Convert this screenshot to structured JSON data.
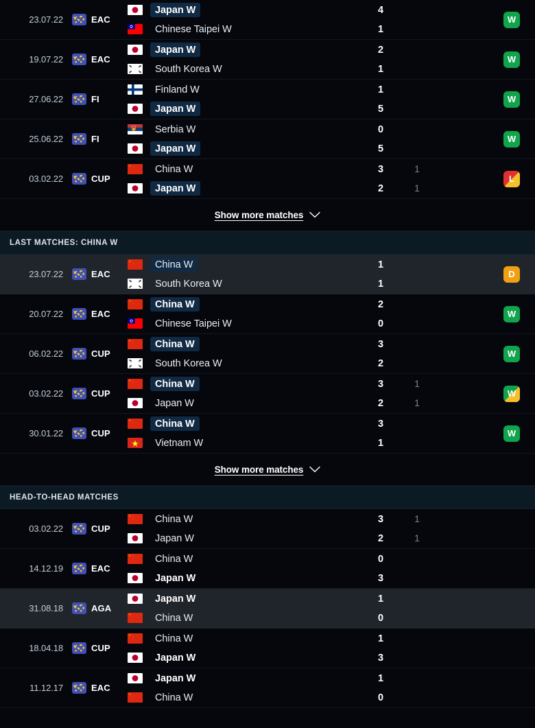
{
  "colors": {
    "page_bg": "#05070d",
    "row_alt_bg": "#20242b",
    "section_header_bg": "#0c1a23",
    "highlight_team_bg": "#112a44",
    "win": "#10a44c",
    "draw": "#f0a011",
    "loss": "#e03030",
    "penalty_corner": "#f5c02a",
    "comp_icon_bg": "#3f51b5"
  },
  "sections": [
    {
      "id": "last-matches-japan",
      "header": null,
      "show_more": {
        "label": "Show more matches",
        "icon": "chevron-down-icon"
      },
      "matches": [
        {
          "date": "23.07.22",
          "competition": "EAC",
          "competition_icon": "world-map-icon",
          "row_highlight": false,
          "home": {
            "team": "Japan W",
            "flag": "japan-flag",
            "score": "4",
            "penalty": "",
            "highlight": true,
            "bold": true
          },
          "away": {
            "team": "Chinese Taipei W",
            "flag": "chinese-taipei-flag",
            "score": "1",
            "penalty": "",
            "highlight": false,
            "bold": false
          },
          "result": {
            "letter": "W",
            "type": "w",
            "corner": false
          }
        },
        {
          "date": "19.07.22",
          "competition": "EAC",
          "competition_icon": "world-map-icon",
          "row_highlight": false,
          "home": {
            "team": "Japan W",
            "flag": "japan-flag",
            "score": "2",
            "penalty": "",
            "highlight": true,
            "bold": true
          },
          "away": {
            "team": "South Korea W",
            "flag": "south-korea-flag",
            "score": "1",
            "penalty": "",
            "highlight": false,
            "bold": false
          },
          "result": {
            "letter": "W",
            "type": "w",
            "corner": false
          }
        },
        {
          "date": "27.06.22",
          "competition": "FI",
          "competition_icon": "world-map-icon",
          "row_highlight": false,
          "home": {
            "team": "Finland W",
            "flag": "finland-flag",
            "score": "1",
            "penalty": "",
            "highlight": false,
            "bold": false
          },
          "away": {
            "team": "Japan W",
            "flag": "japan-flag",
            "score": "5",
            "penalty": "",
            "highlight": true,
            "bold": true
          },
          "result": {
            "letter": "W",
            "type": "w",
            "corner": false
          }
        },
        {
          "date": "25.06.22",
          "competition": "FI",
          "competition_icon": "world-map-icon",
          "row_highlight": false,
          "home": {
            "team": "Serbia W",
            "flag": "serbia-flag",
            "score": "0",
            "penalty": "",
            "highlight": false,
            "bold": false
          },
          "away": {
            "team": "Japan W",
            "flag": "japan-flag",
            "score": "5",
            "penalty": "",
            "highlight": true,
            "bold": true
          },
          "result": {
            "letter": "W",
            "type": "w",
            "corner": false
          }
        },
        {
          "date": "03.02.22",
          "competition": "CUP",
          "competition_icon": "world-map-icon",
          "row_highlight": false,
          "home": {
            "team": "China W",
            "flag": "china-flag",
            "score": "3",
            "penalty": "1",
            "highlight": false,
            "bold": false
          },
          "away": {
            "team": "Japan W",
            "flag": "japan-flag",
            "score": "2",
            "penalty": "1",
            "highlight": true,
            "bold": true
          },
          "result": {
            "letter": "L",
            "type": "l",
            "corner": true
          }
        }
      ]
    },
    {
      "id": "last-matches-china",
      "header": "LAST MATCHES: CHINA W",
      "show_more": {
        "label": "Show more matches",
        "icon": "chevron-down-icon"
      },
      "matches": [
        {
          "date": "23.07.22",
          "competition": "EAC",
          "competition_icon": "world-map-icon",
          "row_highlight": true,
          "home": {
            "team": "China W",
            "flag": "china-flag",
            "score": "1",
            "penalty": "",
            "highlight": true,
            "bold": false
          },
          "away": {
            "team": "South Korea W",
            "flag": "south-korea-flag",
            "score": "1",
            "penalty": "",
            "highlight": false,
            "bold": false
          },
          "result": {
            "letter": "D",
            "type": "d",
            "corner": false
          }
        },
        {
          "date": "20.07.22",
          "competition": "EAC",
          "competition_icon": "world-map-icon",
          "row_highlight": false,
          "home": {
            "team": "China W",
            "flag": "china-flag",
            "score": "2",
            "penalty": "",
            "highlight": true,
            "bold": true
          },
          "away": {
            "team": "Chinese Taipei W",
            "flag": "chinese-taipei-flag",
            "score": "0",
            "penalty": "",
            "highlight": false,
            "bold": false
          },
          "result": {
            "letter": "W",
            "type": "w",
            "corner": false
          }
        },
        {
          "date": "06.02.22",
          "competition": "CUP",
          "competition_icon": "world-map-icon",
          "row_highlight": false,
          "home": {
            "team": "China W",
            "flag": "china-flag",
            "score": "3",
            "penalty": "",
            "highlight": true,
            "bold": true
          },
          "away": {
            "team": "South Korea W",
            "flag": "south-korea-flag",
            "score": "2",
            "penalty": "",
            "highlight": false,
            "bold": false
          },
          "result": {
            "letter": "W",
            "type": "w",
            "corner": false
          }
        },
        {
          "date": "03.02.22",
          "competition": "CUP",
          "competition_icon": "world-map-icon",
          "row_highlight": false,
          "home": {
            "team": "China W",
            "flag": "china-flag",
            "score": "3",
            "penalty": "1",
            "highlight": true,
            "bold": true
          },
          "away": {
            "team": "Japan W",
            "flag": "japan-flag",
            "score": "2",
            "penalty": "1",
            "highlight": false,
            "bold": false
          },
          "result": {
            "letter": "W",
            "type": "w",
            "corner": true
          }
        },
        {
          "date": "30.01.22",
          "competition": "CUP",
          "competition_icon": "world-map-icon",
          "row_highlight": false,
          "home": {
            "team": "China W",
            "flag": "china-flag",
            "score": "3",
            "penalty": "",
            "highlight": true,
            "bold": true
          },
          "away": {
            "team": "Vietnam W",
            "flag": "vietnam-flag",
            "score": "1",
            "penalty": "",
            "highlight": false,
            "bold": false
          },
          "result": {
            "letter": "W",
            "type": "w",
            "corner": false
          }
        }
      ]
    },
    {
      "id": "head-to-head",
      "header": "HEAD-TO-HEAD MATCHES",
      "show_more": null,
      "matches": [
        {
          "date": "03.02.22",
          "competition": "CUP",
          "competition_icon": "world-map-icon",
          "row_highlight": false,
          "home": {
            "team": "China W",
            "flag": "china-flag",
            "score": "3",
            "penalty": "1",
            "highlight": false,
            "bold": false
          },
          "away": {
            "team": "Japan W",
            "flag": "japan-flag",
            "score": "2",
            "penalty": "1",
            "highlight": false,
            "bold": false
          },
          "result": null
        },
        {
          "date": "14.12.19",
          "competition": "EAC",
          "competition_icon": "world-map-icon",
          "row_highlight": false,
          "home": {
            "team": "China W",
            "flag": "china-flag",
            "score": "0",
            "penalty": "",
            "highlight": false,
            "bold": false
          },
          "away": {
            "team": "Japan W",
            "flag": "japan-flag",
            "score": "3",
            "penalty": "",
            "highlight": false,
            "bold": true
          },
          "result": null
        },
        {
          "date": "31.08.18",
          "competition": "AGA",
          "competition_icon": "world-map-icon",
          "row_highlight": true,
          "home": {
            "team": "Japan W",
            "flag": "japan-flag",
            "score": "1",
            "penalty": "",
            "highlight": false,
            "bold": true
          },
          "away": {
            "team": "China W",
            "flag": "china-flag",
            "score": "0",
            "penalty": "",
            "highlight": false,
            "bold": false
          },
          "result": null
        },
        {
          "date": "18.04.18",
          "competition": "CUP",
          "competition_icon": "world-map-icon",
          "row_highlight": false,
          "home": {
            "team": "China W",
            "flag": "china-flag",
            "score": "1",
            "penalty": "",
            "highlight": false,
            "bold": false
          },
          "away": {
            "team": "Japan W",
            "flag": "japan-flag",
            "score": "3",
            "penalty": "",
            "highlight": false,
            "bold": true
          },
          "result": null
        },
        {
          "date": "11.12.17",
          "competition": "EAC",
          "competition_icon": "world-map-icon",
          "row_highlight": false,
          "home": {
            "team": "Japan W",
            "flag": "japan-flag",
            "score": "1",
            "penalty": "",
            "highlight": false,
            "bold": true
          },
          "away": {
            "team": "China W",
            "flag": "china-flag",
            "score": "0",
            "penalty": "",
            "highlight": false,
            "bold": false
          },
          "result": null
        }
      ]
    }
  ]
}
